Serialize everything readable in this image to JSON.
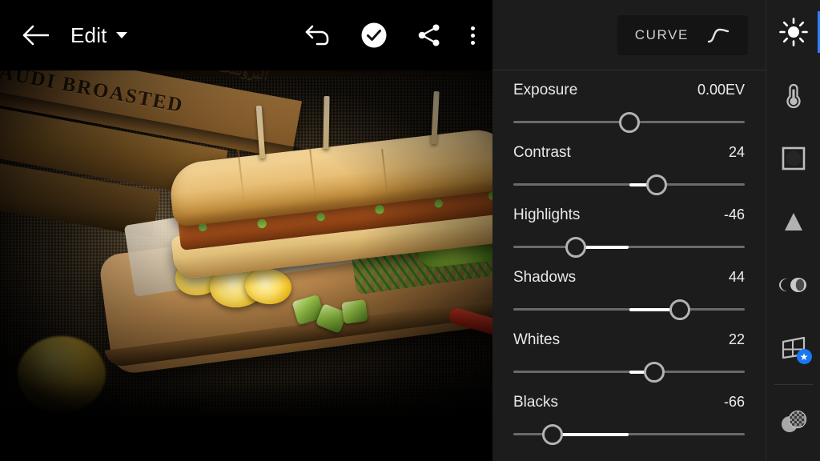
{
  "app": {
    "title": "Edit",
    "theme_bg": "#1c1c1c",
    "accent": "#2d7ff9"
  },
  "topbar": {
    "back_label": "Back",
    "mode_label": "Edit",
    "dropdown_icon": "caret-down-icon",
    "actions": [
      {
        "name": "undo-button",
        "icon": "undo-icon",
        "label": "Undo"
      },
      {
        "name": "apply-button",
        "icon": "check-circle-icon",
        "label": "Apply"
      },
      {
        "name": "share-button",
        "icon": "share-icon",
        "label": "Share"
      },
      {
        "name": "more-button",
        "icon": "overflow-menu-icon",
        "label": "More options"
      }
    ]
  },
  "panel": {
    "curve_button": {
      "label": "CURVE",
      "icon": "tone-curve-icon"
    },
    "sliders": [
      {
        "name": "exposure",
        "label": "Exposure",
        "value": "0.00EV",
        "num": 0,
        "min": -100,
        "max": 100
      },
      {
        "name": "contrast",
        "label": "Contrast",
        "value": "24",
        "num": 24,
        "min": -100,
        "max": 100
      },
      {
        "name": "highlights",
        "label": "Highlights",
        "value": "-46",
        "num": -46,
        "min": -100,
        "max": 100
      },
      {
        "name": "shadows",
        "label": "Shadows",
        "value": "44",
        "num": 44,
        "min": -100,
        "max": 100
      },
      {
        "name": "whites",
        "label": "Whites",
        "value": "22",
        "num": 22,
        "min": -100,
        "max": 100
      },
      {
        "name": "blacks",
        "label": "Blacks",
        "value": "-66",
        "num": -66,
        "min": -100,
        "max": 100
      }
    ]
  },
  "rail": {
    "items": [
      {
        "name": "light",
        "icon": "sun-icon",
        "label": "Light",
        "active": true,
        "badge": ""
      },
      {
        "name": "color",
        "icon": "thermometer-icon",
        "label": "Color",
        "active": false,
        "badge": ""
      },
      {
        "name": "effects",
        "icon": "square-vignette-icon",
        "label": "Effects",
        "active": false,
        "badge": ""
      },
      {
        "name": "detail",
        "icon": "triangle-icon",
        "label": "Detail",
        "active": false,
        "badge": ""
      },
      {
        "name": "optics",
        "icon": "lens-icon",
        "label": "Optics",
        "active": false,
        "badge": ""
      },
      {
        "name": "geometry",
        "icon": "perspective-grid-icon",
        "label": "Geometry",
        "active": false,
        "badge": "star"
      }
    ],
    "bottom_items": [
      {
        "name": "masking",
        "icon": "overlapping-circles-icon",
        "label": "Masking",
        "active": false,
        "badge": ""
      }
    ]
  },
  "photo": {
    "alt": "Submarine sandwich on wooden cutting board with lemon, chili, cucumber and rosemary",
    "crate_text": "SAUDI BROASTED",
    "crate_text_arabic": "البروست السعودي"
  }
}
